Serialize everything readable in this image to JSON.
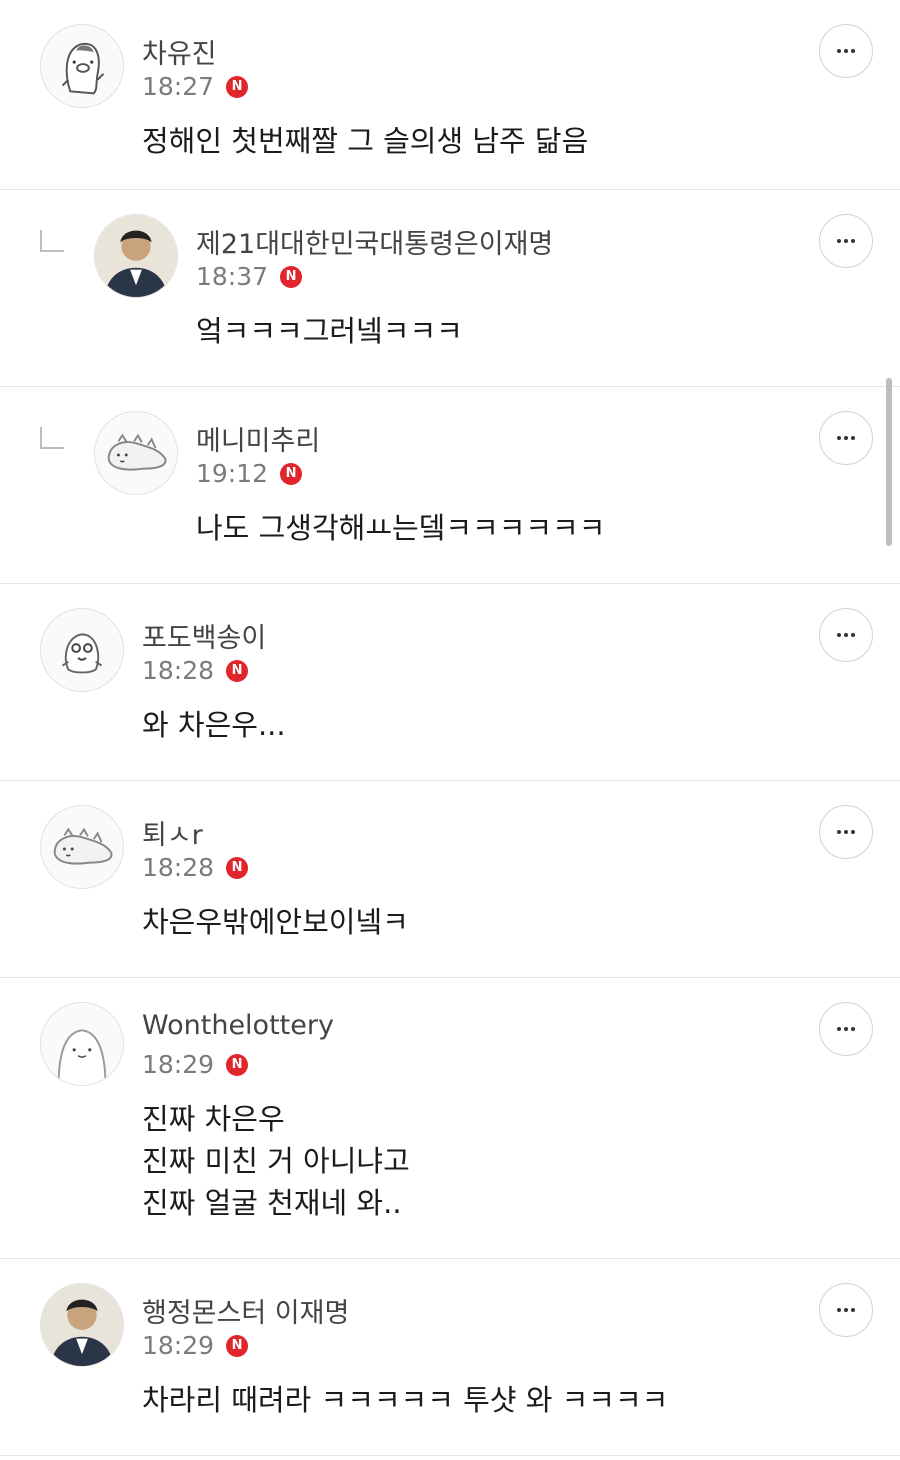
{
  "comments": [
    {
      "author": "차유진",
      "time": "18:27",
      "badge": "N",
      "is_reply": false,
      "avatar": "penguin-avatar-icon",
      "lines": [
        "정해인 첫번째짤 그 슬의생 남주 닮음"
      ]
    },
    {
      "author": "제21대대한민국대통령은이재명",
      "time": "18:37",
      "badge": "N",
      "is_reply": true,
      "avatar": "person-photo-avatar",
      "lines": [
        "엌ㅋㅋㅋ그러넼ㅋㅋㅋ"
      ]
    },
    {
      "author": "메니미추리",
      "time": "19:12",
      "badge": "N",
      "is_reply": true,
      "avatar": "dinosaur-avatar-icon",
      "lines": [
        "나도 그생각해ㅛ는뎈ㅋㅋㅋㅋㅋㅋ"
      ]
    },
    {
      "author": "포도백송이",
      "time": "18:28",
      "badge": "N",
      "is_reply": false,
      "avatar": "blob-avatar-icon",
      "lines": [
        "와 차은우..."
      ]
    },
    {
      "author": "퇴ㅅr",
      "time": "18:28",
      "badge": "N",
      "is_reply": false,
      "avatar": "dinosaur-avatar-icon",
      "lines": [
        "차은우밖에안보이넼ㅋ"
      ]
    },
    {
      "author": "Wonthelottery",
      "time": "18:29",
      "badge": "N",
      "is_reply": false,
      "avatar": "round-face-avatar-icon",
      "lines": [
        "진짜 차은우",
        "진짜 미친 거 아니냐고",
        "진짜 얼굴 천재네 와.."
      ]
    },
    {
      "author": "행정몬스터 이재명",
      "time": "18:29",
      "badge": "N",
      "is_reply": false,
      "avatar": "person-photo-avatar",
      "lines": [
        "차라리 때려라 ㅋㅋㅋㅋㅋ 투샷 와 ㅋㅋㅋㅋ"
      ]
    }
  ],
  "colors": {
    "badge": "#e0252b",
    "divider": "#e6e6e6",
    "author": "#444444",
    "time": "#7b7b7b"
  }
}
